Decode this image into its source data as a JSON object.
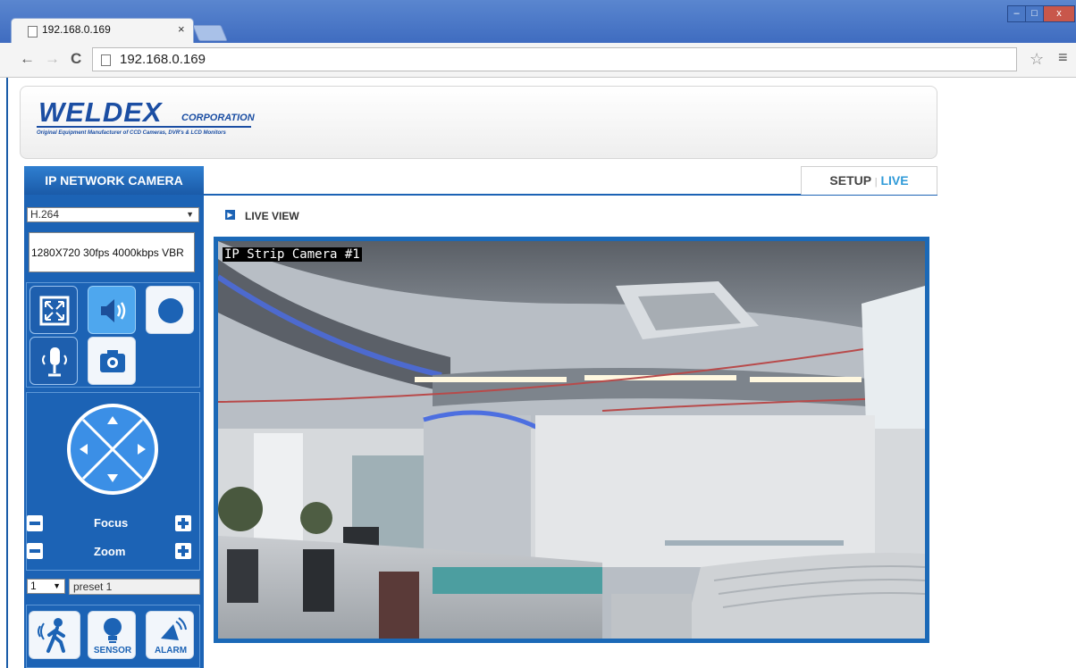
{
  "browser": {
    "tab_title": "192.168.0.169",
    "tab_close": "×",
    "url": "192.168.0.169",
    "window_controls": [
      "–",
      "□",
      "x"
    ]
  },
  "header": {
    "logo_name": "WELDEX",
    "logo_corp": "CORPORATION",
    "logo_tagline": "Original Equipment Manufacturer of CCD Cameras, DVR's & LCD Monitors"
  },
  "sidebar": {
    "title": "IP NETWORK CAMERA",
    "codec": "H.264",
    "stream_info": "1280X720 30fps 4000kbps VBR",
    "controls": [
      {
        "name": "fullscreen",
        "icon": "fullscreen-icon"
      },
      {
        "name": "audio",
        "icon": "speaker-icon"
      },
      {
        "name": "record",
        "icon": "record-icon"
      },
      {
        "name": "microphone",
        "icon": "microphone-icon"
      },
      {
        "name": "snapshot",
        "icon": "camera-icon"
      }
    ],
    "focus_label": "Focus",
    "zoom_label": "Zoom",
    "preset_number": "1",
    "preset_name": "preset 1",
    "bottom_buttons": [
      {
        "name": "motion",
        "icon": "motion-icon",
        "label": ""
      },
      {
        "name": "sensor",
        "icon": "sensor-icon",
        "label": "SENSOR"
      },
      {
        "name": "alarm",
        "icon": "alarm-icon",
        "label": "ALARM"
      }
    ]
  },
  "tabs": {
    "setup": "SETUP",
    "separator": "|",
    "live": "LIVE"
  },
  "main": {
    "section_title": "LIVE VIEW",
    "camera_osd": "IP Strip Camera #1"
  },
  "colors": {
    "brand_blue": "#1c63b5",
    "accent_light_blue": "#2f9ad8"
  }
}
